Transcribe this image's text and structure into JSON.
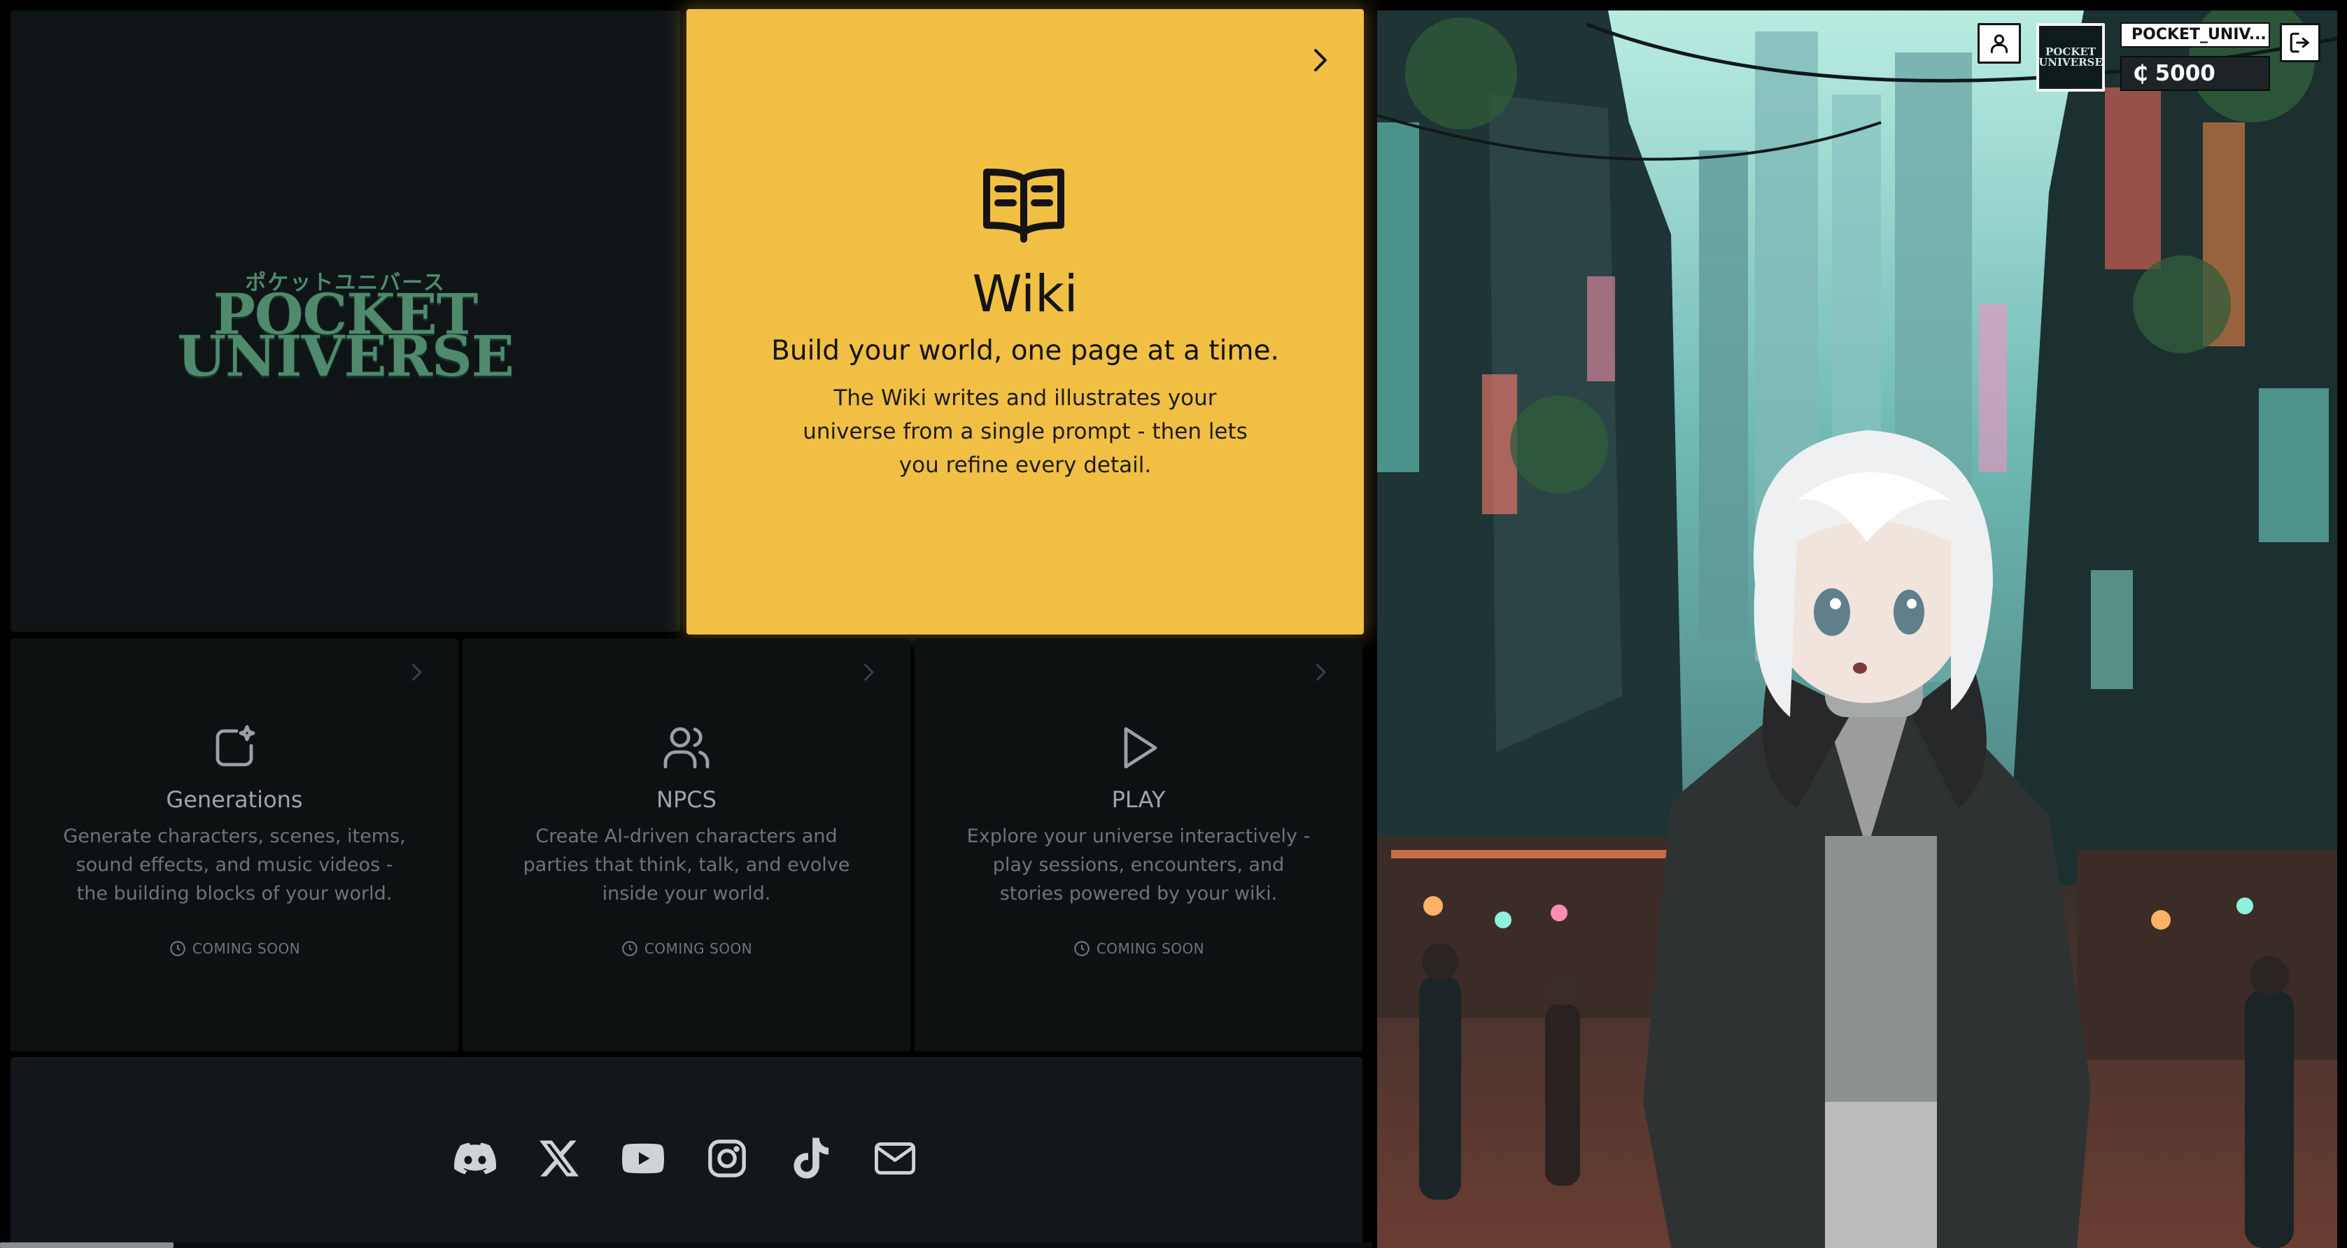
{
  "colors": {
    "accent": "#f2bf45",
    "logo": "#4f8a6d",
    "card_bg": "#0e1112",
    "footer_bg": "#11171a"
  },
  "brand": {
    "kana": "ポケットユニバース",
    "line1": "POCKET",
    "line2": "UNIVERSE"
  },
  "wiki": {
    "icon": "book-open-icon",
    "title": "Wiki",
    "tagline": "Build your world, one page at a time.",
    "description": "The Wiki writes and illustrates your universe from a single prompt - then lets you refine every detail."
  },
  "features": [
    {
      "icon": "sparkle-square-icon",
      "title": "Generations",
      "description": "Generate characters, scenes, items, sound effects, and music videos - the building blocks of your world.",
      "status": "COMING SOON"
    },
    {
      "icon": "users-icon",
      "title": "NPCS",
      "description": "Create AI-driven characters and parties that think, talk, and evolve inside your world.",
      "status": "COMING SOON"
    },
    {
      "icon": "play-icon",
      "title": "PLAY",
      "description": "Explore your universe interactively - play sessions, encounters, and stories powered by your wiki.",
      "status": "COMING SOON"
    }
  ],
  "social": [
    "discord-icon",
    "x-icon",
    "youtube-icon",
    "instagram-icon",
    "tiktok-icon",
    "mail-icon"
  ],
  "hud": {
    "avatar_line1": "POCKET",
    "avatar_line2": "UNIVERSE",
    "username": "POCKET_UNIV...",
    "currency_symbol": "₵",
    "credits": "5000"
  }
}
